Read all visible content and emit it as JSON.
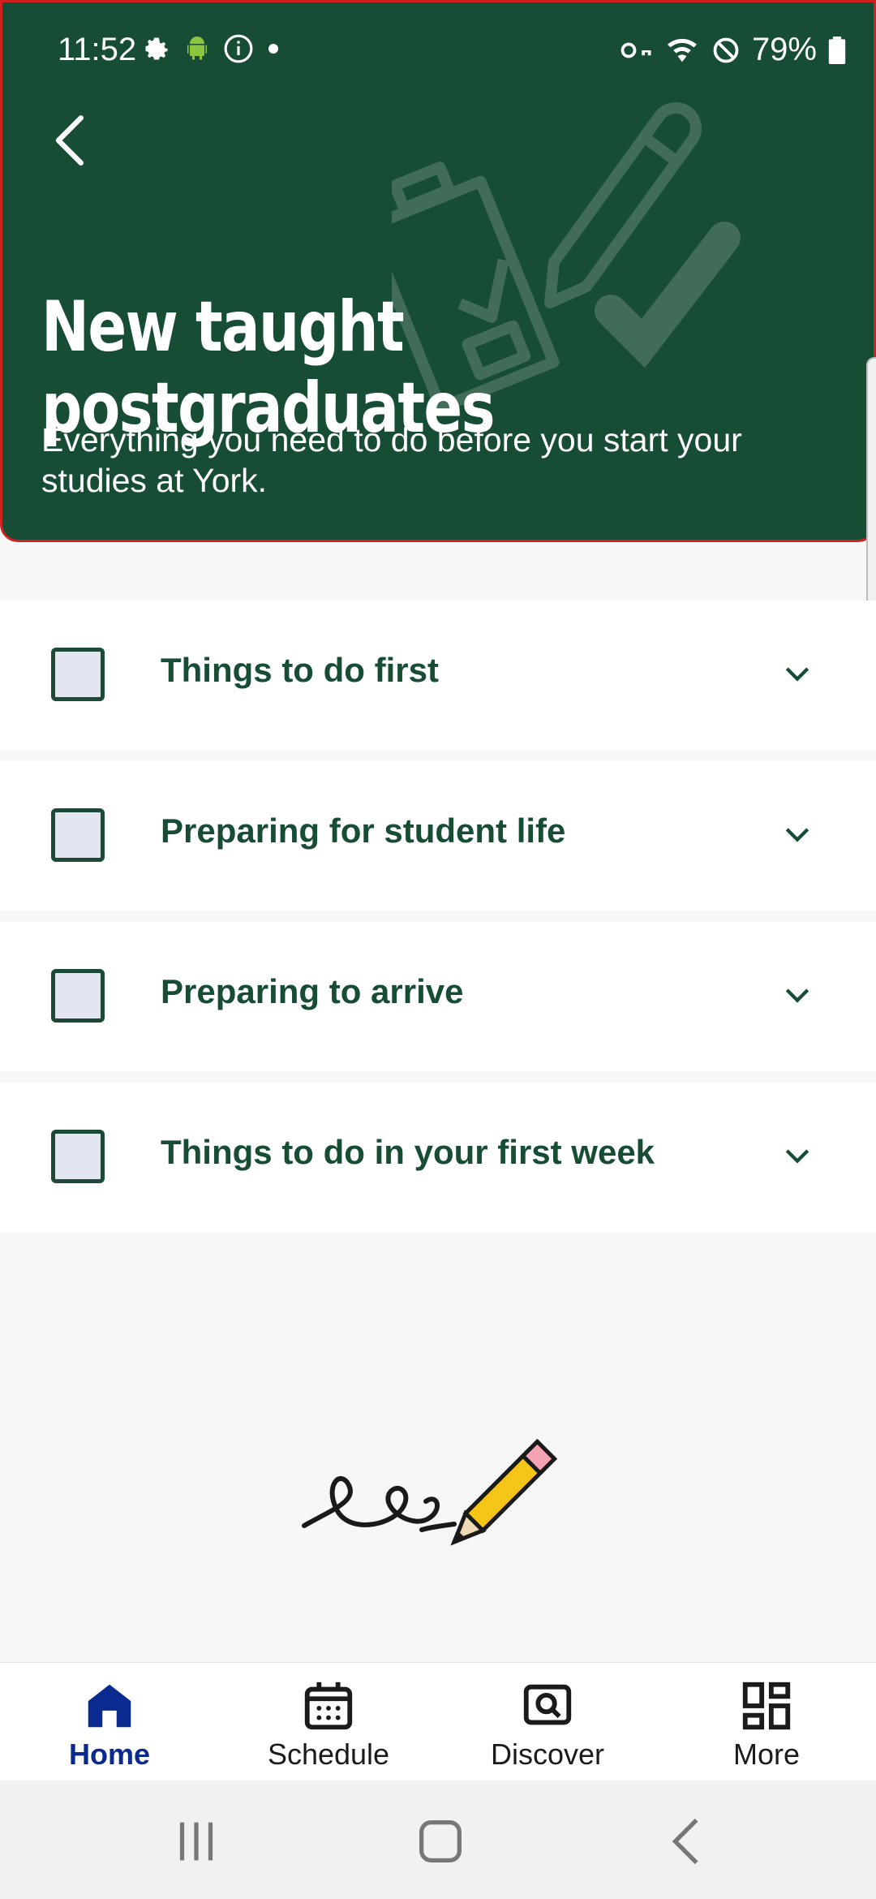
{
  "status_bar": {
    "time": "11:52",
    "battery": "79%"
  },
  "header": {
    "title": "New taught postgraduates",
    "subtitle": "Everything you need to do before you start your studies at York."
  },
  "checklist": {
    "items": [
      {
        "label": "Things to do first"
      },
      {
        "label": "Preparing for student life"
      },
      {
        "label": "Preparing to arrive"
      },
      {
        "label": "Things to do in your first week"
      }
    ]
  },
  "bottom_nav": {
    "items": [
      {
        "label": "Home",
        "icon": "home-icon",
        "active": true
      },
      {
        "label": "Schedule",
        "icon": "calendar-icon",
        "active": false
      },
      {
        "label": "Discover",
        "icon": "discover-icon",
        "active": false
      },
      {
        "label": "More",
        "icon": "grid-icon",
        "active": false
      }
    ]
  },
  "colors": {
    "header_bg": "#174c35",
    "accent_nav": "#0b2a8f",
    "checkbox_fill": "#e3e6f1"
  }
}
